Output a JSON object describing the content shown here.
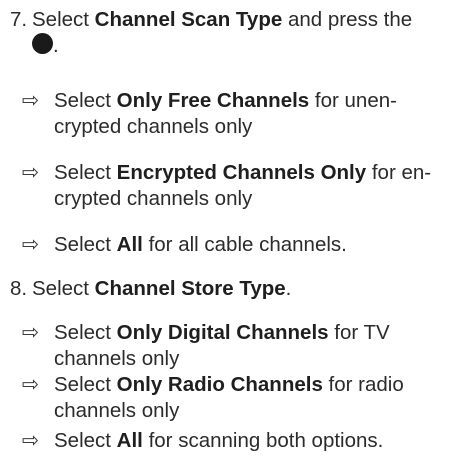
{
  "steps": [
    {
      "number": "7.",
      "pre": "Select ",
      "bold": "Channel Scan Type",
      "post": " and press the",
      "button_icon": "ok-button-icon",
      "end": ".",
      "subs": [
        {
          "arrow": "⇨",
          "pre": "Select ",
          "bold": "Only Free Channels",
          "post": " for unen-",
          "line2": "crypted channels only"
        },
        {
          "arrow": "⇨",
          "pre": "Select ",
          "bold": "Encrypted Channels Only",
          "post": " for en-",
          "line2": "crypted channels only"
        },
        {
          "arrow": "⇨",
          "pre": "Select ",
          "bold": "All",
          "post": " for all cable channels.",
          "line2": ""
        }
      ]
    },
    {
      "number": "8.",
      "pre": "Select ",
      "bold": "Channel Store Type",
      "post": ".",
      "subs": [
        {
          "arrow": "⇨",
          "pre": "Select ",
          "bold": "Only Digital Channels",
          "post": " for TV",
          "line2": "channels only"
        },
        {
          "arrow": "⇨",
          "pre": "Select ",
          "bold": "Only Radio Channels",
          "post": " for radio",
          "line2": "channels only"
        },
        {
          "arrow": "⇨",
          "pre": "Select ",
          "bold": "All",
          "post": " for scanning both options.",
          "line2": ""
        }
      ]
    }
  ]
}
